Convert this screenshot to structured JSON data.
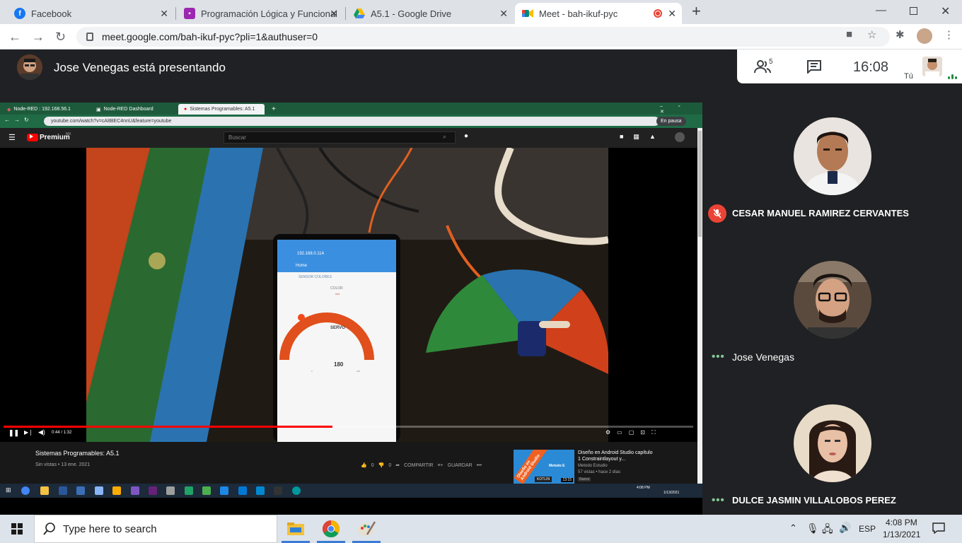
{
  "browser": {
    "tabs": [
      {
        "label": "Facebook",
        "icon": "facebook-icon",
        "color": "#1877f2"
      },
      {
        "label": "Programación Lógica y Funcional",
        "icon": "classroom-icon",
        "color": "#9c27b0"
      },
      {
        "label": "A5.1 - Google Drive",
        "icon": "drive-icon",
        "color": "#fbbc04"
      },
      {
        "label": "Meet - bah-ikuf-pyc",
        "icon": "meet-icon",
        "color": "#00897b"
      }
    ],
    "url": "meet.google.com/bah-ikuf-pyc?pli=1&authuser=0"
  },
  "meet": {
    "presenting": "Jose Venegas está presentando",
    "people_count": "5",
    "time": "16:08",
    "self_label": "Tú",
    "participants": [
      {
        "name": "CESAR MANUEL RAMIREZ CERVANTES",
        "muted": true
      },
      {
        "name": "Jose Venegas",
        "muted": false
      },
      {
        "name": "DULCE JASMIN VILLALOBOS PEREZ",
        "muted": false
      }
    ]
  },
  "shared_screen": {
    "tabs": [
      "Node-RED : 192.168.56.1",
      "Node-RED Dashboard",
      "Sistemas Programables: A5.1"
    ],
    "url": "youtube.com/watch?v=cA8BEC4nnU&feature=youtube",
    "paused_label": "En pausa",
    "youtube": {
      "logo": "Premium",
      "logo_sup": "MX",
      "search_placeholder": "Buscar",
      "time": "0:44 / 1:32",
      "progress": 0.477,
      "title": "Sistemas Programables: A5.1",
      "meta": "Sin vistas • 13 ene. 2021",
      "likes": "0",
      "dislikes": "0",
      "share": "COMPARTIR",
      "save": "GUARDAR",
      "rec_title": "Diseño en Android Studio capítulo 1 Constraintlayout y...",
      "rec_channel": "Metodo Estudio",
      "rec_meta": "57 vistas • hace 2 días",
      "rec_badge": "Nuevo",
      "rec_duration": "13:15",
      "rec_thumb": [
        "Diseño en Android Studio",
        "KOTLIN",
        "Metodo E"
      ]
    },
    "phone": {
      "url": "192.168.0.114",
      "home": "Home",
      "sensor": "SENSOR COLORES",
      "color_label": "COLOR",
      "color_value": "red",
      "servo": "SERVO",
      "gauge_value": "180",
      "gauge_min": "0",
      "gauge_max": "180"
    },
    "taskbar_time": "4:08 PM",
    "taskbar_date": "1/13/2021"
  },
  "taskbar": {
    "search_placeholder": "Type here to search",
    "lang": "ESP",
    "time": "4:08 PM",
    "date": "1/13/2021"
  }
}
